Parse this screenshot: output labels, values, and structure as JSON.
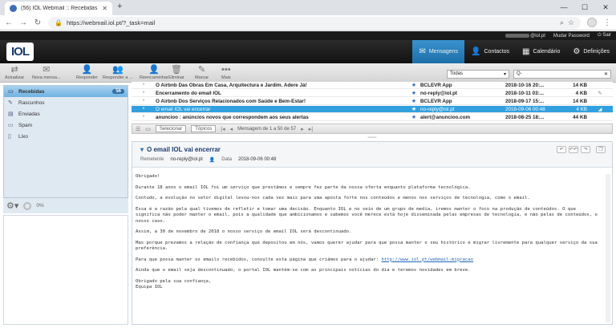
{
  "browser": {
    "tab_title": "(56) IOL Webmail :: Recebidas",
    "url": "https://webmail.iol.pt/?_task=mail"
  },
  "userbar": {
    "user": "@iol.pt",
    "change_password": "Mudar Password",
    "logout": "Sair"
  },
  "logo": "IOL",
  "topnav": [
    {
      "label": "Mensagens",
      "icon": "envelope-icon"
    },
    {
      "label": "Contactos",
      "icon": "person-icon"
    },
    {
      "label": "Calendário",
      "icon": "calendar-icon"
    },
    {
      "label": "Definições",
      "icon": "gear-icon"
    }
  ],
  "toolbar": [
    {
      "label": "Actualizar",
      "icon": "refresh-icon"
    },
    {
      "label": "Nova mensa...",
      "icon": "compose-icon"
    },
    {
      "label": "Responder",
      "icon": "reply-icon"
    },
    {
      "label": "Responder a ...",
      "icon": "reply-all-icon"
    },
    {
      "label": "Reencaminhar",
      "icon": "forward-icon"
    },
    {
      "label": "Eliminar",
      "icon": "trash-icon"
    },
    {
      "label": "Marcar",
      "icon": "mark-icon"
    },
    {
      "label": "Mais",
      "icon": "more-icon"
    }
  ],
  "filter": {
    "value": "Todas"
  },
  "search": {
    "placeholder": "Q-"
  },
  "folders": [
    {
      "name": "Recebidas",
      "count": "56",
      "icon": "inbox-icon",
      "active": true
    },
    {
      "name": "Rascunhos",
      "count": "",
      "icon": "pencil-icon",
      "active": false
    },
    {
      "name": "Enviadas",
      "count": "",
      "icon": "sent-icon",
      "active": false
    },
    {
      "name": "Spam",
      "count": "",
      "icon": "spam-icon",
      "active": false
    },
    {
      "name": "Lixo",
      "count": "",
      "icon": "trash-icon",
      "active": false
    }
  ],
  "quota": "0%",
  "messages": [
    {
      "subject": "O Airbnb Das Obras Em Casa, Arquitectura e Jardim. Adere Já!",
      "from": "BCLEVR App",
      "date": "2018-10-16 20:...",
      "size": "14 KB"
    },
    {
      "subject": "Encerramento do email IOL",
      "from": "no-reply@iol.pt",
      "date": "2018-10-11 03:...",
      "size": "4 KB"
    },
    {
      "subject": "O Airbnb Dos Serviços Relacionados com Saúde e Bem-Estar!",
      "from": "BCLEVR App",
      "date": "2018-09-17 15:...",
      "size": "14 KB"
    },
    {
      "subject": "O email IOL vai encerrar",
      "from": "no-reply@iol.pt",
      "date": "2018-09-06 00:48",
      "size": "4 KB"
    },
    {
      "subject": "anuncioo : anúncios novos que correspondem aos seus alertas",
      "from": "alert@anuncioo.com",
      "date": "2018-08-25 18:...",
      "size": "44 KB"
    }
  ],
  "listfoot": {
    "select": "Selecionar",
    "threads": "Tópicos",
    "count": "Mensagem de 1 a 50 de 57"
  },
  "preview": {
    "subject": "O email IOL vai encerrar",
    "sender_label": "Remetente",
    "sender": "no-reply@iol.pt",
    "date_label": "Data",
    "date": "2018-09-06 00:48",
    "body": [
      "Obrigado!",
      "Durante 18 anos o email IOL foi um serviço que prestámos e sempre fez parte da nossa oferta enquanto plataforma tecnológica.",
      "Contudo, a evolução no setor digital levou-nos cada vez mais para uma aposta forte nos conteúdos e menos nos serviços de tecnologia, como o email.",
      "Essa é a razão pela qual tivemos de refletir e tomar uma decisão. Enquanto IOL e no seio de um grupo de media, iremos manter o foco na produção de conteúdos. O que significa não poder manter o email, pois a qualidade que ambicionamos e sabemos você merece está hoje disseminada pelas empresas de tecnologia, e não pelas de conteúdos, o nosso caso.",
      "Assim, a 30 de novembro de 2018 o nosso serviço de email IOL será descontinuado.",
      "Mas porque prezamos a relação de confiança que depositou em nós, vamos querer ajudar para que possa manter o seu histórico e migrar livremente para qualquer serviço da sua preferência.",
      "Para que possa manter os emails recebidos, consulte esta página que criámos para o ajudar:",
      "Ainda que o email seja descontinuado, o portal IOL mantém-se com as principais notícias do dia e teremos novidades em breve.",
      "Obrigado pela sua confiança,",
      "Equipa IOL"
    ],
    "link": "http://www.iol.pt/webmail-migracao"
  }
}
